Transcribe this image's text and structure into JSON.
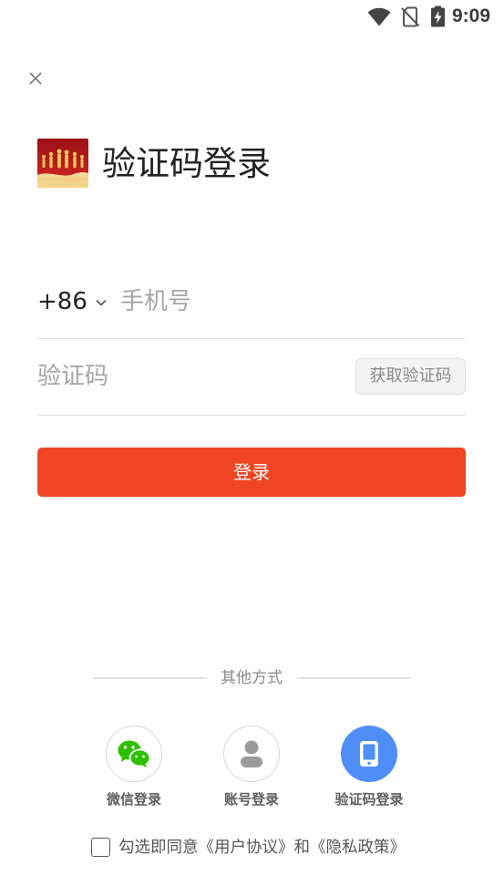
{
  "status_bar": {
    "time": "9:09",
    "icons": [
      "wifi-icon",
      "no-sim-icon",
      "battery-charging-icon"
    ]
  },
  "header": {
    "close_icon": "close-icon",
    "logo": "app-logo",
    "title": "验证码登录"
  },
  "form": {
    "country_code": "+86",
    "country_icon": "chevron-down-icon",
    "phone_placeholder": "手机号",
    "code_placeholder": "验证码",
    "get_code_label": "获取验证码",
    "login_label": "登录"
  },
  "other_methods": {
    "title": "其他方式",
    "items": [
      {
        "label": "微信登录",
        "icon": "wechat-icon",
        "active": false
      },
      {
        "label": "账号登录",
        "icon": "user-icon",
        "active": false
      },
      {
        "label": "验证码登录",
        "icon": "phone-icon",
        "active": true
      }
    ]
  },
  "agreement": {
    "checked": false,
    "prefix": "勾选即同意",
    "terms_link": "《用户协议》",
    "conjunction": "和",
    "privacy_link": "《隐私政策》"
  },
  "colors": {
    "accent": "#F04524",
    "active_method": "#4F8EF7",
    "wechat": "#2DC100"
  }
}
